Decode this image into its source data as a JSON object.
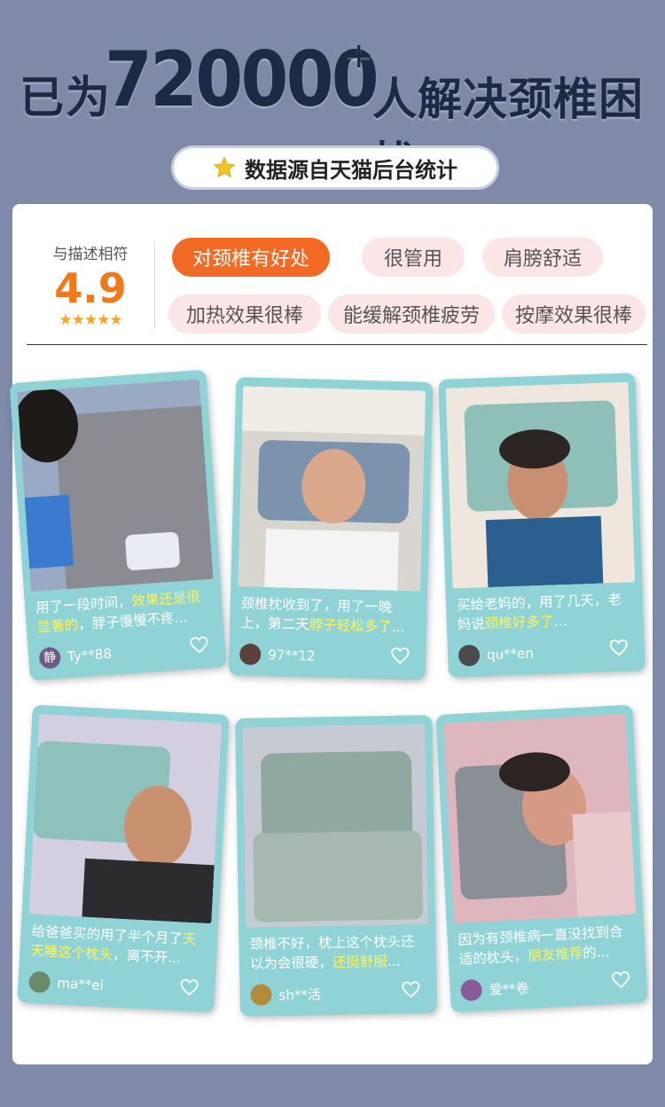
{
  "headline": {
    "prefix": "已为",
    "number": "720000",
    "plus": "+",
    "suffix": "人解决颈椎困扰"
  },
  "source_note": "数据源自天猫后台统计",
  "rating": {
    "label": "与描述相符",
    "score": "4.9",
    "stars": "★★★★★"
  },
  "tags": [
    "对颈椎有好处",
    "很管用",
    "肩膀舒适",
    "加热效果很棒",
    "能缓解颈椎疲劳",
    "按摩效果很棒"
  ],
  "colors": {
    "background": "#7e8aa8",
    "card": "#8fd3d6",
    "accent": "#f26a24",
    "highlight": "#fff35a",
    "tag": "#fbe5e6"
  },
  "reviews": [
    {
      "pre": "用了一段时间，",
      "hl": "效果还是很显著的",
      "post": "，脖子慢慢不疼...",
      "user": "Ty**88",
      "avatar": "静"
    },
    {
      "pre": "颈椎枕收到了，用了一晚上，第二天",
      "hl": "脖子轻松多了",
      "post": "...",
      "user": "97**12",
      "avatar": ""
    },
    {
      "pre": "买给老妈的，用了几天，老妈说",
      "hl": "颈椎好多了",
      "post": "...",
      "user": "qu**en",
      "avatar": ""
    },
    {
      "pre": "给爸爸买的用了半个月了",
      "hl": "天天睡这个枕头",
      "post": "，离不开...",
      "user": "ma**ei",
      "avatar": ""
    },
    {
      "pre": "颈椎不好，枕上这个枕头还以为会很硬，",
      "hl": "还挺舒服",
      "post": "...",
      "user": "sh**活",
      "avatar": ""
    },
    {
      "pre": "因为有颈椎病一直没找到合适的枕头，",
      "hl": "朋友推荐",
      "post": "的...",
      "user": "爱**卷",
      "avatar": ""
    }
  ]
}
